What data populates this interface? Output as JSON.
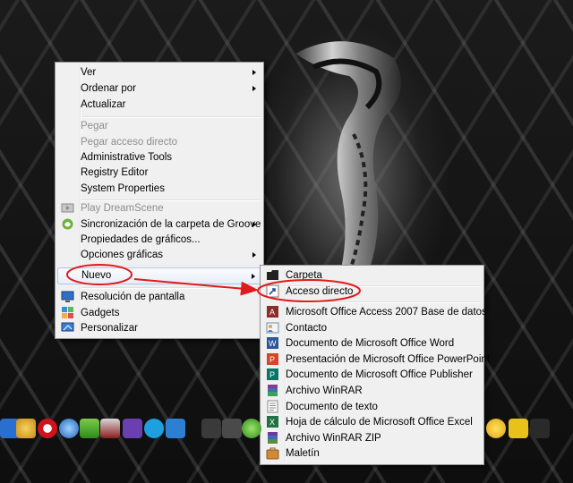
{
  "context_menu": {
    "items": [
      {
        "label": "Ver",
        "submenu": true
      },
      {
        "label": "Ordenar por",
        "submenu": true
      },
      {
        "label": "Actualizar"
      },
      {
        "label": "Pegar",
        "disabled": true
      },
      {
        "label": "Pegar acceso directo",
        "disabled": true
      },
      {
        "label": "Administrative Tools"
      },
      {
        "label": "Registry Editor"
      },
      {
        "label": "System Properties"
      },
      {
        "label": "Play DreamScene",
        "disabled": true
      },
      {
        "label": "Sincronización de la carpeta de Groove",
        "submenu": true
      },
      {
        "label": "Propiedades de gráficos..."
      },
      {
        "label": "Opciones gráficas",
        "submenu": true
      },
      {
        "label": "Nuevo",
        "submenu": true
      },
      {
        "label": "Resolución de pantalla"
      },
      {
        "label": "Gadgets"
      },
      {
        "label": "Personalizar"
      }
    ]
  },
  "new_submenu": {
    "items": [
      {
        "label": "Carpeta"
      },
      {
        "label": "Acceso directo"
      },
      {
        "label": "Microsoft Office Access 2007 Base de datos"
      },
      {
        "label": "Contacto"
      },
      {
        "label": "Documento de Microsoft Office Word"
      },
      {
        "label": "Presentación de Microsoft Office PowerPoint"
      },
      {
        "label": "Documento de Microsoft Office Publisher"
      },
      {
        "label": "Archivo WinRAR"
      },
      {
        "label": "Documento de texto"
      },
      {
        "label": "Hoja de cálculo de Microsoft Office Excel"
      },
      {
        "label": "Archivo WinRAR ZIP"
      },
      {
        "label": "Maletín"
      }
    ]
  },
  "annotation": {
    "color": "#e01b1b"
  },
  "taskbar": {
    "icons": [
      "app-icon",
      "messenger-icon",
      "opera-icon",
      "globe-icon",
      "ares-icon",
      "freeupload-icon",
      "acrobat-icon",
      "download-icon",
      "skype-icon",
      "download-manager-icon",
      "folder-icon",
      "folder-icon",
      "green-arrow-icon",
      "smiley-icon",
      "star-icon",
      "trash-icon"
    ]
  }
}
